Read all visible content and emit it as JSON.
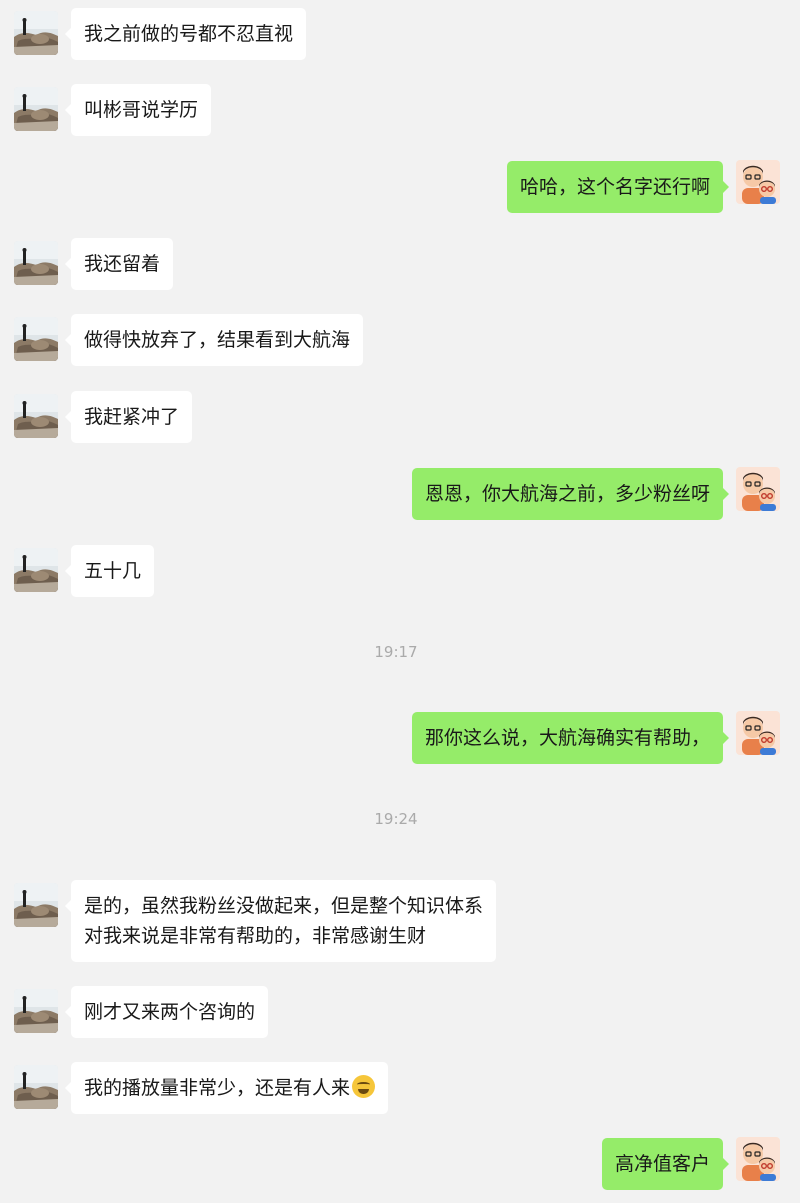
{
  "messages": [
    {
      "side": "in",
      "lines": [
        "我之前做的号都不忍直视"
      ]
    },
    {
      "side": "in",
      "lines": [
        "叫彬哥说学历"
      ]
    },
    {
      "side": "out",
      "lines": [
        "哈哈，这个名字还行啊"
      ]
    },
    {
      "side": "in",
      "lines": [
        "我还留着"
      ]
    },
    {
      "side": "in",
      "lines": [
        "做得快放弃了，结果看到大航海"
      ]
    },
    {
      "side": "in",
      "lines": [
        "我赶紧冲了"
      ]
    },
    {
      "side": "out",
      "lines": [
        "恩恩，你大航海之前，多少粉丝呀"
      ]
    },
    {
      "side": "in",
      "lines": [
        "五十几"
      ]
    },
    {
      "timestamp": "19:17"
    },
    {
      "side": "out",
      "lines": [
        "那你这么说，大航海确实有帮助，"
      ]
    },
    {
      "timestamp": "19:24"
    },
    {
      "side": "in",
      "lines": [
        "是的，虽然我粉丝没做起来，但是整个知识体系",
        "对我来说是非常有帮助的，非常感谢生财"
      ]
    },
    {
      "side": "in",
      "lines": [
        "刚才又来两个咨询的"
      ]
    },
    {
      "side": "in",
      "lines": [
        "我的播放量非常少，还是有人来"
      ],
      "emoji": "crying-laughing-emoji"
    },
    {
      "side": "out",
      "lines": [
        "高净值客户"
      ]
    }
  ],
  "avatars": {
    "in": "seaside-rock-photo-avatar",
    "out": "cartoon-couple-avatar"
  },
  "colors": {
    "background": "#f2f2f2",
    "incoming_bubble": "#ffffff",
    "outgoing_bubble": "#95ec69",
    "timestamp": "#aaaaaa"
  }
}
